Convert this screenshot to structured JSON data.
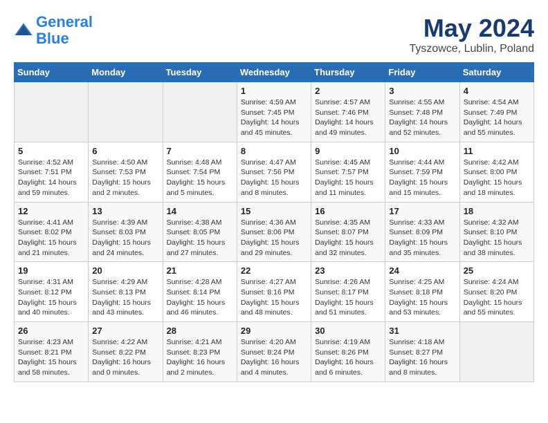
{
  "header": {
    "logo_line1": "General",
    "logo_line2": "Blue",
    "month": "May 2024",
    "location": "Tyszowce, Lublin, Poland"
  },
  "weekdays": [
    "Sunday",
    "Monday",
    "Tuesday",
    "Wednesday",
    "Thursday",
    "Friday",
    "Saturday"
  ],
  "weeks": [
    [
      {
        "day": "",
        "info": ""
      },
      {
        "day": "",
        "info": ""
      },
      {
        "day": "",
        "info": ""
      },
      {
        "day": "1",
        "info": "Sunrise: 4:59 AM\nSunset: 7:45 PM\nDaylight: 14 hours\nand 45 minutes."
      },
      {
        "day": "2",
        "info": "Sunrise: 4:57 AM\nSunset: 7:46 PM\nDaylight: 14 hours\nand 49 minutes."
      },
      {
        "day": "3",
        "info": "Sunrise: 4:55 AM\nSunset: 7:48 PM\nDaylight: 14 hours\nand 52 minutes."
      },
      {
        "day": "4",
        "info": "Sunrise: 4:54 AM\nSunset: 7:49 PM\nDaylight: 14 hours\nand 55 minutes."
      }
    ],
    [
      {
        "day": "5",
        "info": "Sunrise: 4:52 AM\nSunset: 7:51 PM\nDaylight: 14 hours\nand 59 minutes."
      },
      {
        "day": "6",
        "info": "Sunrise: 4:50 AM\nSunset: 7:53 PM\nDaylight: 15 hours\nand 2 minutes."
      },
      {
        "day": "7",
        "info": "Sunrise: 4:48 AM\nSunset: 7:54 PM\nDaylight: 15 hours\nand 5 minutes."
      },
      {
        "day": "8",
        "info": "Sunrise: 4:47 AM\nSunset: 7:56 PM\nDaylight: 15 hours\nand 8 minutes."
      },
      {
        "day": "9",
        "info": "Sunrise: 4:45 AM\nSunset: 7:57 PM\nDaylight: 15 hours\nand 11 minutes."
      },
      {
        "day": "10",
        "info": "Sunrise: 4:44 AM\nSunset: 7:59 PM\nDaylight: 15 hours\nand 15 minutes."
      },
      {
        "day": "11",
        "info": "Sunrise: 4:42 AM\nSunset: 8:00 PM\nDaylight: 15 hours\nand 18 minutes."
      }
    ],
    [
      {
        "day": "12",
        "info": "Sunrise: 4:41 AM\nSunset: 8:02 PM\nDaylight: 15 hours\nand 21 minutes."
      },
      {
        "day": "13",
        "info": "Sunrise: 4:39 AM\nSunset: 8:03 PM\nDaylight: 15 hours\nand 24 minutes."
      },
      {
        "day": "14",
        "info": "Sunrise: 4:38 AM\nSunset: 8:05 PM\nDaylight: 15 hours\nand 27 minutes."
      },
      {
        "day": "15",
        "info": "Sunrise: 4:36 AM\nSunset: 8:06 PM\nDaylight: 15 hours\nand 29 minutes."
      },
      {
        "day": "16",
        "info": "Sunrise: 4:35 AM\nSunset: 8:07 PM\nDaylight: 15 hours\nand 32 minutes."
      },
      {
        "day": "17",
        "info": "Sunrise: 4:33 AM\nSunset: 8:09 PM\nDaylight: 15 hours\nand 35 minutes."
      },
      {
        "day": "18",
        "info": "Sunrise: 4:32 AM\nSunset: 8:10 PM\nDaylight: 15 hours\nand 38 minutes."
      }
    ],
    [
      {
        "day": "19",
        "info": "Sunrise: 4:31 AM\nSunset: 8:12 PM\nDaylight: 15 hours\nand 40 minutes."
      },
      {
        "day": "20",
        "info": "Sunrise: 4:29 AM\nSunset: 8:13 PM\nDaylight: 15 hours\nand 43 minutes."
      },
      {
        "day": "21",
        "info": "Sunrise: 4:28 AM\nSunset: 8:14 PM\nDaylight: 15 hours\nand 46 minutes."
      },
      {
        "day": "22",
        "info": "Sunrise: 4:27 AM\nSunset: 8:16 PM\nDaylight: 15 hours\nand 48 minutes."
      },
      {
        "day": "23",
        "info": "Sunrise: 4:26 AM\nSunset: 8:17 PM\nDaylight: 15 hours\nand 51 minutes."
      },
      {
        "day": "24",
        "info": "Sunrise: 4:25 AM\nSunset: 8:18 PM\nDaylight: 15 hours\nand 53 minutes."
      },
      {
        "day": "25",
        "info": "Sunrise: 4:24 AM\nSunset: 8:20 PM\nDaylight: 15 hours\nand 55 minutes."
      }
    ],
    [
      {
        "day": "26",
        "info": "Sunrise: 4:23 AM\nSunset: 8:21 PM\nDaylight: 15 hours\nand 58 minutes."
      },
      {
        "day": "27",
        "info": "Sunrise: 4:22 AM\nSunset: 8:22 PM\nDaylight: 16 hours\nand 0 minutes."
      },
      {
        "day": "28",
        "info": "Sunrise: 4:21 AM\nSunset: 8:23 PM\nDaylight: 16 hours\nand 2 minutes."
      },
      {
        "day": "29",
        "info": "Sunrise: 4:20 AM\nSunset: 8:24 PM\nDaylight: 16 hours\nand 4 minutes."
      },
      {
        "day": "30",
        "info": "Sunrise: 4:19 AM\nSunset: 8:26 PM\nDaylight: 16 hours\nand 6 minutes."
      },
      {
        "day": "31",
        "info": "Sunrise: 4:18 AM\nSunset: 8:27 PM\nDaylight: 16 hours\nand 8 minutes."
      },
      {
        "day": "",
        "info": ""
      }
    ]
  ]
}
